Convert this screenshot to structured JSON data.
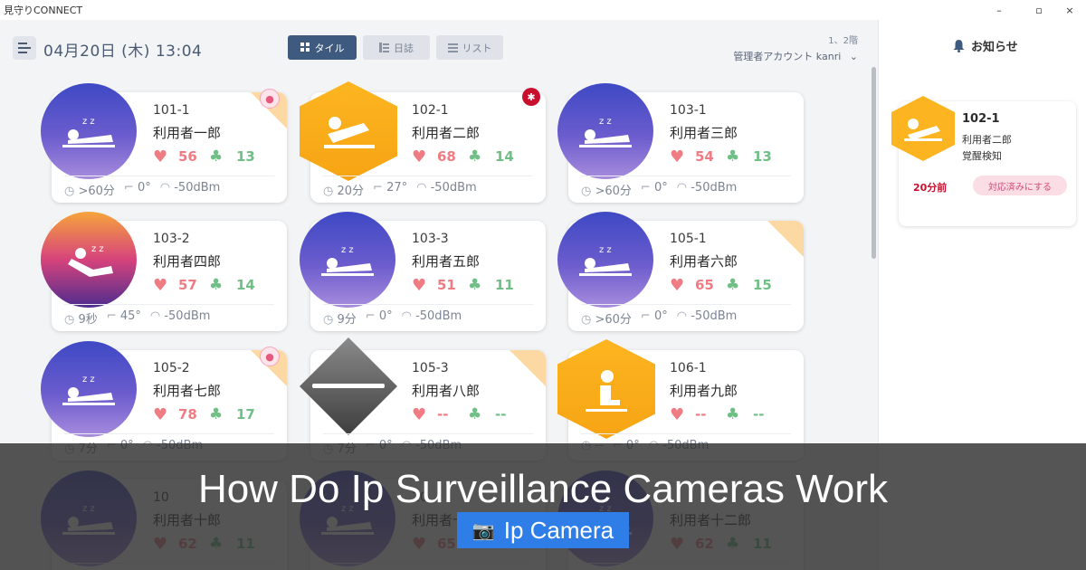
{
  "window": {
    "title": "見守りCONNECT",
    "controls": [
      "–",
      "▫",
      "×"
    ]
  },
  "header": {
    "date": "04月20日 (木) 13:04",
    "tabs": [
      {
        "label": "タイル",
        "icon": "grid-icon",
        "active": true
      },
      {
        "label": "日誌",
        "icon": "journal-icon",
        "active": false
      },
      {
        "label": "リスト",
        "icon": "list-icon",
        "active": false
      }
    ],
    "pager": "1、2階",
    "account": "管理者アカウント kanri"
  },
  "residents": [
    {
      "room": "101-1",
      "name": "利用者一郎",
      "hr": "56",
      "rr": "13",
      "dur": ">60分",
      "angle": "0°",
      "signal": "-50dBm",
      "icon": "sleeping-icon",
      "alert": "bell"
    },
    {
      "room": "102-1",
      "name": "利用者二郎",
      "hr": "68",
      "rr": "14",
      "dur": "20分",
      "angle": "27°",
      "signal": "-50dBm",
      "icon": "waking-icon",
      "alert": "red"
    },
    {
      "room": "103-1",
      "name": "利用者三郎",
      "hr": "54",
      "rr": "13",
      "dur": ">60分",
      "angle": "0°",
      "signal": "-50dBm",
      "icon": "sleeping-icon",
      "alert": ""
    },
    {
      "room": "103-2",
      "name": "利用者四郎",
      "hr": "57",
      "rr": "14",
      "dur": "9秒",
      "angle": "45°",
      "signal": "-50dBm",
      "icon": "reclined-sleep-icon",
      "alert": ""
    },
    {
      "room": "103-3",
      "name": "利用者五郎",
      "hr": "51",
      "rr": "11",
      "dur": "9分",
      "angle": "0°",
      "signal": "-50dBm",
      "icon": "sleeping-icon",
      "alert": ""
    },
    {
      "room": "105-1",
      "name": "利用者六郎",
      "hr": "65",
      "rr": "15",
      "dur": ">60分",
      "angle": "0°",
      "signal": "-50dBm",
      "icon": "sleeping-icon",
      "alert": "corner"
    },
    {
      "room": "105-2",
      "name": "利用者七郎",
      "hr": "78",
      "rr": "17",
      "dur": "7分",
      "angle": "0°",
      "signal": "-50dBm",
      "icon": "sleeping-icon",
      "alert": "bell"
    },
    {
      "room": "105-3",
      "name": "利用者八郎",
      "hr": "--",
      "rr": "--",
      "dur": "7分",
      "angle": "0°",
      "signal": "-50dBm",
      "icon": "empty-bed-icon",
      "alert": "corner"
    },
    {
      "room": "106-1",
      "name": "利用者九郎",
      "hr": "--",
      "rr": "--",
      "dur": "--",
      "angle": "0°",
      "signal": "-50dBm",
      "icon": "sitting-icon",
      "alert": ""
    },
    {
      "room": "10",
      "name": "利用者十郎",
      "hr": "62",
      "rr": "11",
      "dur": "",
      "angle": "",
      "signal": "",
      "icon": "sleeping-icon",
      "alert": ""
    },
    {
      "room": "10",
      "name": "利用者十一郎",
      "hr": "65",
      "rr": "",
      "dur": "",
      "angle": "",
      "signal": "",
      "icon": "sleeping-icon",
      "alert": ""
    },
    {
      "room": "",
      "name": "利用者十二郎",
      "hr": "62",
      "rr": "11",
      "dur": "",
      "angle": "",
      "signal": "",
      "icon": "sleeping-icon",
      "alert": ""
    }
  ],
  "notifications": {
    "title": "お知らせ",
    "items": [
      {
        "room": "102-1",
        "name": "利用者二郎",
        "event": "覚醒検知",
        "time": "20分前",
        "action": "対応済みにする"
      }
    ]
  },
  "overlay": {
    "headline": "How Do Ip Surveillance Cameras Work",
    "tag": "Ip Camera",
    "tag_icon": "camera-icon"
  },
  "colors": {
    "accent": "#3e5a7e",
    "heart": "#ef7b83",
    "lung": "#6fbf86",
    "alert": "#c8102e",
    "tag": "#2f7ee8"
  }
}
